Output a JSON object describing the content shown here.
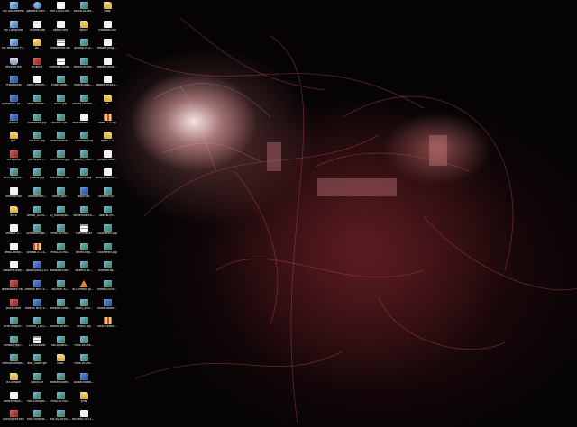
{
  "desktop": {
    "wallpaper": "abstract-red-light-swirls",
    "accent_color": "#b33a44",
    "icon_label_color": "#ffffff",
    "icons": [
      {
        "label": "My Documents",
        "type": "system",
        "icon": "my-documents-icon"
      },
      {
        "label": "My Computer",
        "type": "system",
        "icon": "my-computer-icon"
      },
      {
        "label": "My Network Places",
        "type": "system",
        "icon": "network-places-icon"
      },
      {
        "label": "Recycle Bin",
        "type": "bin",
        "icon": "recycle-bin-icon"
      },
      {
        "label": "Processing",
        "type": "app",
        "icon": "app-icon"
      },
      {
        "label": "Symantec pcAnywhere",
        "type": "app",
        "icon": "app-icon"
      },
      {
        "label": "Picasa",
        "type": "app",
        "icon": "app-icon"
      },
      {
        "label": "gcc",
        "type": "folder",
        "icon": "folder-icon"
      },
      {
        "label": "YOrNBase",
        "type": "exe",
        "icon": "exe-icon"
      },
      {
        "label": "bcm-diagno...",
        "type": "image",
        "icon": "image-icon"
      },
      {
        "label": "Untitled.cpl",
        "type": "doc",
        "icon": "document-icon"
      },
      {
        "label": "euro",
        "type": "folder",
        "icon": "folder-icon"
      },
      {
        "label": "Velox-1.1...",
        "type": "doc",
        "icon": "document-icon"
      },
      {
        "label": "Velox-analy...",
        "type": "doc",
        "icon": "document-icon"
      },
      {
        "label": "WeatherDisp...",
        "type": "doc",
        "icon": "document-icon"
      },
      {
        "label": "Breakdown flair form...",
        "type": "exe",
        "icon": "exe-icon"
      },
      {
        "label": "pulley.exe",
        "type": "exe",
        "icon": "exe-icon"
      },
      {
        "label": "bcm-diagno...",
        "type": "image",
        "icon": "image-icon"
      },
      {
        "label": "kindall_figu...",
        "type": "image",
        "icon": "image-icon"
      },
      {
        "label": "MeshAndImps...",
        "type": "image",
        "icon": "image-icon"
      },
      {
        "label": "d3-simple",
        "type": "folder",
        "icon": "folder-icon"
      },
      {
        "label": "bookcrossin...",
        "type": "doc",
        "icon": "document-icon"
      },
      {
        "label": "pulleyjoint.exe",
        "type": "exe",
        "icon": "exe-icon"
      },
      {
        "label": "gazette.com...",
        "type": "web",
        "icon": "web-icon"
      },
      {
        "label": "Thumbs.db",
        "type": "doc",
        "icon": "document-icon"
      },
      {
        "label": "AE",
        "type": "folder",
        "icon": "folder-icon"
      },
      {
        "label": "RGWEB",
        "type": "exe",
        "icon": "exe-icon"
      },
      {
        "label": "open-reenm...",
        "type": "doc",
        "icon": "document-icon"
      },
      {
        "label": "snap-edoxe...",
        "type": "image",
        "icon": "image-icon"
      },
      {
        "label": "Facebook.jpg",
        "type": "image",
        "icon": "image-icon"
      },
      {
        "label": "cocktai.jpg",
        "type": "image",
        "icon": "image-icon"
      },
      {
        "label": "pyrus-peri...",
        "type": "image",
        "icon": "image-icon"
      },
      {
        "label": "sidous.jpg",
        "type": "image",
        "icon": "image-icon"
      },
      {
        "label": "Traldowned...",
        "type": "image",
        "icon": "image-icon"
      },
      {
        "label": "photo_4234...",
        "type": "image",
        "icon": "image-icon"
      },
      {
        "label": "scaldechuge...",
        "type": "image",
        "icon": "image-icon"
      },
      {
        "label": "pnpBB-3.1.4...",
        "type": "archive",
        "icon": "archive-icon"
      },
      {
        "label": "Apophysis 2.02",
        "type": "app",
        "icon": "app-icon"
      },
      {
        "label": "Intellix NPO Version C...",
        "type": "app",
        "icon": "app-icon"
      },
      {
        "label": "Intellix NPO Version C...",
        "type": "app",
        "icon": "app-icon"
      },
      {
        "label": "curvee_1232...",
        "type": "image",
        "icon": "image-icon"
      },
      {
        "label": "11-multi.txt",
        "type": "text",
        "icon": "text-file-icon"
      },
      {
        "label": "alto_zoom.gif",
        "type": "image",
        "icon": "image-icon"
      },
      {
        "label": "juskyo.tif",
        "type": "image",
        "icon": "image-icon"
      },
      {
        "label": "non-cdnsrat...",
        "type": "image",
        "icon": "image-icon"
      },
      {
        "label": "non-cdnsrat...",
        "type": "image",
        "icon": "image-icon"
      },
      {
        "label": "HIM CATEGRY...",
        "type": "doc",
        "icon": "document-icon"
      },
      {
        "label": "nprocr.dst",
        "type": "doc",
        "icon": "document-icon"
      },
      {
        "label": "modemidi.txt",
        "type": "text",
        "icon": "text-file-icon"
      },
      {
        "label": "sitemap-p2ps...",
        "type": "text",
        "icon": "text-file-icon"
      },
      {
        "label": "chain-grbe...",
        "type": "image",
        "icon": "image-icon"
      },
      {
        "label": "dcsd.jpg",
        "type": "image",
        "icon": "image-icon"
      },
      {
        "label": "ubuntu-sys...",
        "type": "image",
        "icon": "image-icon"
      },
      {
        "label": "obamakelie...",
        "type": "image",
        "icon": "image-icon"
      },
      {
        "label": "sumtrans.jpg",
        "type": "image",
        "icon": "image-icon"
      },
      {
        "label": "macksnan-co...",
        "type": "image",
        "icon": "image-icon"
      },
      {
        "label": "malo_spe...",
        "type": "image",
        "icon": "image-icon"
      },
      {
        "label": "Q_nokilayss...",
        "type": "image",
        "icon": "image-icon"
      },
      {
        "label": "mno-vc-mli...",
        "type": "image",
        "icon": "image-icon"
      },
      {
        "label": "mno-vc-mli...",
        "type": "image",
        "icon": "image-icon"
      },
      {
        "label": "kosbate-libe...",
        "type": "image",
        "icon": "image-icon"
      },
      {
        "label": "Kocttch Xi...",
        "type": "image",
        "icon": "image-icon"
      },
      {
        "label": "tenada-vcee...",
        "type": "image",
        "icon": "image-icon"
      },
      {
        "label": "boost-Jarvis...",
        "type": "image",
        "icon": "image-icon"
      },
      {
        "label": "nbl-pyosnc...",
        "type": "image",
        "icon": "image-icon"
      },
      {
        "label": "llaac",
        "type": "folder",
        "icon": "folder-icon"
      },
      {
        "label": "Rotteroutier...",
        "type": "image",
        "icon": "image-icon"
      },
      {
        "label": "mno-vc-mli...",
        "type": "image",
        "icon": "image-icon"
      },
      {
        "label": "sol-vs-phylu...",
        "type": "image",
        "icon": "image-icon"
      },
      {
        "label": "beloit-vs-lev...",
        "type": "image",
        "icon": "image-icon"
      },
      {
        "label": "sprite",
        "type": "folder",
        "icon": "folder-icon"
      },
      {
        "label": "gNoop-vs-p...",
        "type": "image",
        "icon": "image-icon"
      },
      {
        "label": "beloit-vs-lev...",
        "type": "image",
        "icon": "image-icon"
      },
      {
        "label": "alterstudio-...",
        "type": "image",
        "icon": "image-icon"
      },
      {
        "label": "Zeneo Halfelver de...",
        "type": "image",
        "icon": "image-icon"
      },
      {
        "label": "Telecommu... Policy Stat...",
        "type": "doc",
        "icon": "document-icon"
      },
      {
        "label": "Clifknap.png",
        "type": "image",
        "icon": "image-icon"
      },
      {
        "label": "gpu02_mon...",
        "type": "image",
        "icon": "image-icon"
      },
      {
        "label": "Report.jpg",
        "type": "image",
        "icon": "image-icon"
      },
      {
        "label": "ArgoUML",
        "type": "app",
        "icon": "app-icon"
      },
      {
        "label": "tamenivantu...",
        "type": "image",
        "icon": "image-icon"
      },
      {
        "label": "ruentus.txt",
        "type": "text",
        "icon": "text-file-icon"
      },
      {
        "label": "TeamSheg...",
        "type": "image",
        "icon": "image-icon"
      },
      {
        "label": "xttzero-lip...",
        "type": "image",
        "icon": "image-icon"
      },
      {
        "label": "VLC media player",
        "type": "media",
        "icon": "vlc-icon"
      },
      {
        "label": "MAIN_uitd...",
        "type": "image",
        "icon": "image-icon"
      },
      {
        "label": "pnpt4.jpg",
        "type": "image",
        "icon": "image-icon"
      },
      {
        "label": "mno-vc-mli...",
        "type": "image",
        "icon": "image-icon"
      },
      {
        "label": "mno-vc-mli...",
        "type": "image",
        "icon": "image-icon"
      },
      {
        "label": "Audacitiadd...",
        "type": "app",
        "icon": "app-icon"
      },
      {
        "label": "sms",
        "type": "folder",
        "icon": "folder-icon"
      },
      {
        "label": "WUMBS Se Developer.doc",
        "type": "doc",
        "icon": "document-icon"
      },
      {
        "label": "blog",
        "type": "folder",
        "icon": "folder-icon"
      },
      {
        "label": "vitodeos.csv",
        "type": "doc",
        "icon": "document-icon"
      },
      {
        "label": "Mabile-plugi...",
        "type": "doc",
        "icon": "document-icon"
      },
      {
        "label": "Mabile-plugi...",
        "type": "doc",
        "icon": "document-icon"
      },
      {
        "label": "Mabile-plug.p...",
        "type": "doc",
        "icon": "document-icon"
      },
      {
        "label": "dl",
        "type": "folder",
        "icon": "folder-icon"
      },
      {
        "label": "stats-1.5.zip",
        "type": "archive",
        "icon": "archive-icon"
      },
      {
        "label": "stats-1.5",
        "type": "folder",
        "icon": "folder-icon"
      },
      {
        "label": "people-dow...",
        "type": "doc",
        "icon": "document-icon"
      },
      {
        "label": "people-doml... ore.1.4.1",
        "type": "doc",
        "icon": "document-icon"
      },
      {
        "label": "scnavw-lyr...",
        "type": "image",
        "icon": "image-icon"
      },
      {
        "label": "sbavw-lyr...",
        "type": "image",
        "icon": "image-icon"
      },
      {
        "label": "courtere4.jpg",
        "type": "image",
        "icon": "image-icon"
      },
      {
        "label": "courtere4.jpg",
        "type": "image",
        "icon": "image-icon"
      },
      {
        "label": "ovetoltrap...",
        "type": "image",
        "icon": "image-icon"
      },
      {
        "label": "rvtebe200fx...",
        "type": "image",
        "icon": "image-icon"
      },
      {
        "label": "audacitaddl...",
        "type": "app",
        "icon": "app-icon"
      },
      {
        "label": "GeSHi-WbUl...",
        "type": "archive",
        "icon": "archive-icon"
      }
    ]
  }
}
